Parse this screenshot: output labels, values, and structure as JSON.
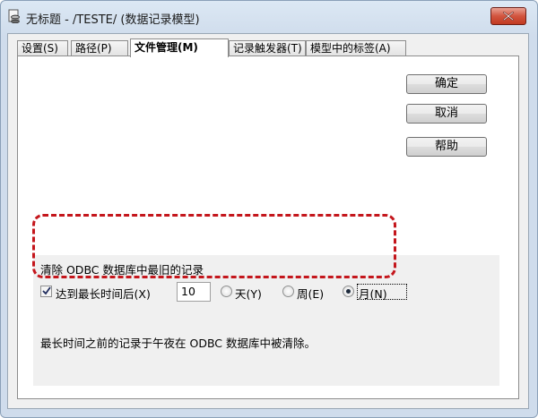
{
  "window": {
    "title": "无标题 - /TESTE/ (数据记录模型)"
  },
  "tabs": [
    {
      "label": "设置(S)",
      "active": false
    },
    {
      "label": "路径(P)",
      "active": false
    },
    {
      "label": "文件管理(M)",
      "active": true
    },
    {
      "label": "记录触发器(T)",
      "active": false
    },
    {
      "label": "模型中的标签(A)",
      "active": false
    }
  ],
  "buttons": {
    "ok": "确定",
    "cancel": "取消",
    "help": "帮助"
  },
  "purge": {
    "title": "清除 ODBC 数据库中最旧的记录",
    "checkbox_label": "达到最长时间后(X)",
    "checkbox_checked": true,
    "value": "10",
    "options": [
      {
        "label": "天(Y)",
        "checked": false
      },
      {
        "label": "周(E)",
        "checked": false
      },
      {
        "label": "月(N)",
        "checked": true
      }
    ],
    "description": "最长时间之前的记录于午夜在 ODBC 数据库中被清除。"
  },
  "colors": {
    "highlight": "#c4161c",
    "close_button": "#c23b22"
  }
}
